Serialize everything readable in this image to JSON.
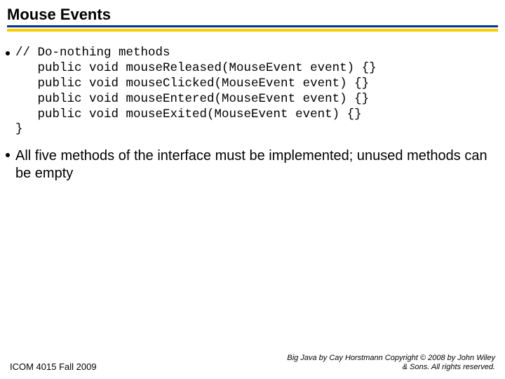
{
  "title": "Mouse Events",
  "code": "// Do-nothing methods\n   public void mouseReleased(MouseEvent event) {}\n   public void mouseClicked(MouseEvent event) {}\n   public void mouseEntered(MouseEvent event) {}\n   public void mouseExited(MouseEvent event) {}\n}",
  "bullet2": "All five methods of the interface must be implemented; unused methods can be empty",
  "footer": {
    "left": "ICOM 4015 Fall 2009",
    "right": "Big Java by Cay Horstmann Copyright © 2008 by John Wiley & Sons.  All rights reserved."
  }
}
